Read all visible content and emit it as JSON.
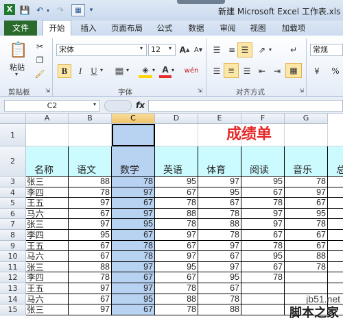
{
  "window": {
    "title": "新建 Microsoft Excel 工作表.xls [兼"
  },
  "ribbon_tabs": {
    "file": "文件",
    "home": "开始",
    "insert": "插入",
    "layout": "页面布局",
    "formula": "公式",
    "data": "数据",
    "review": "审阅",
    "view": "视图",
    "addins": "加载项"
  },
  "ribbon": {
    "paste": "粘贴",
    "font_name": "宋体",
    "font_size": "12",
    "bold": "B",
    "italic": "I",
    "underline": "U",
    "font_color_glyph": "A",
    "highlight_glyph": "A",
    "number_format": "常规",
    "percent": "%",
    "wen": "wén",
    "groups": {
      "clipboard": "剪贴板",
      "font": "字体",
      "alignment": "对齐方式"
    }
  },
  "formula_bar": {
    "cell_ref": "C2",
    "fx": "fx",
    "value": ""
  },
  "sheet": {
    "columns": [
      "A",
      "B",
      "C",
      "D",
      "E",
      "F",
      "G"
    ],
    "rows": [
      "1",
      "2",
      "3",
      "4",
      "5",
      "6",
      "7",
      "8",
      "9",
      "10",
      "11",
      "12",
      "13",
      "14",
      "15"
    ],
    "title": "成绩单",
    "headers": [
      "名称",
      "语文",
      "数学",
      "英语",
      "体育",
      "阅读",
      "音乐",
      "总"
    ],
    "data": [
      [
        "张三",
        "88",
        "78",
        "95",
        "97",
        "95",
        "78"
      ],
      [
        "李四",
        "78",
        "97",
        "67",
        "95",
        "67",
        "97"
      ],
      [
        "王五",
        "97",
        "67",
        "78",
        "67",
        "78",
        "67"
      ],
      [
        "马六",
        "67",
        "97",
        "88",
        "78",
        "97",
        "95"
      ],
      [
        "张三",
        "97",
        "95",
        "78",
        "88",
        "97",
        "78"
      ],
      [
        "李四",
        "95",
        "67",
        "97",
        "78",
        "67",
        "67"
      ],
      [
        "王五",
        "67",
        "78",
        "67",
        "97",
        "78",
        "67"
      ],
      [
        "马六",
        "67",
        "78",
        "97",
        "67",
        "95",
        "88"
      ],
      [
        "张三",
        "88",
        "97",
        "95",
        "97",
        "67",
        "78"
      ],
      [
        "李四",
        "78",
        "67",
        "67",
        "95",
        "78",
        "",
        ""
      ],
      [
        "王五",
        "97",
        "97",
        "78",
        "67",
        "",
        "",
        ""
      ],
      [
        "马六",
        "67",
        "95",
        "88",
        "78",
        "",
        "",
        ""
      ],
      [
        "张三",
        "97",
        "67",
        "78",
        "88",
        "",
        "",
        ""
      ]
    ]
  },
  "watermark": {
    "site": "jb51.net",
    "name": "脚本之家"
  },
  "colors": {
    "title_red": "#e52b2b",
    "header_cyan": "#ccfbff",
    "selection": "#b8d2f2",
    "file_tab": "#2a6a2d"
  }
}
